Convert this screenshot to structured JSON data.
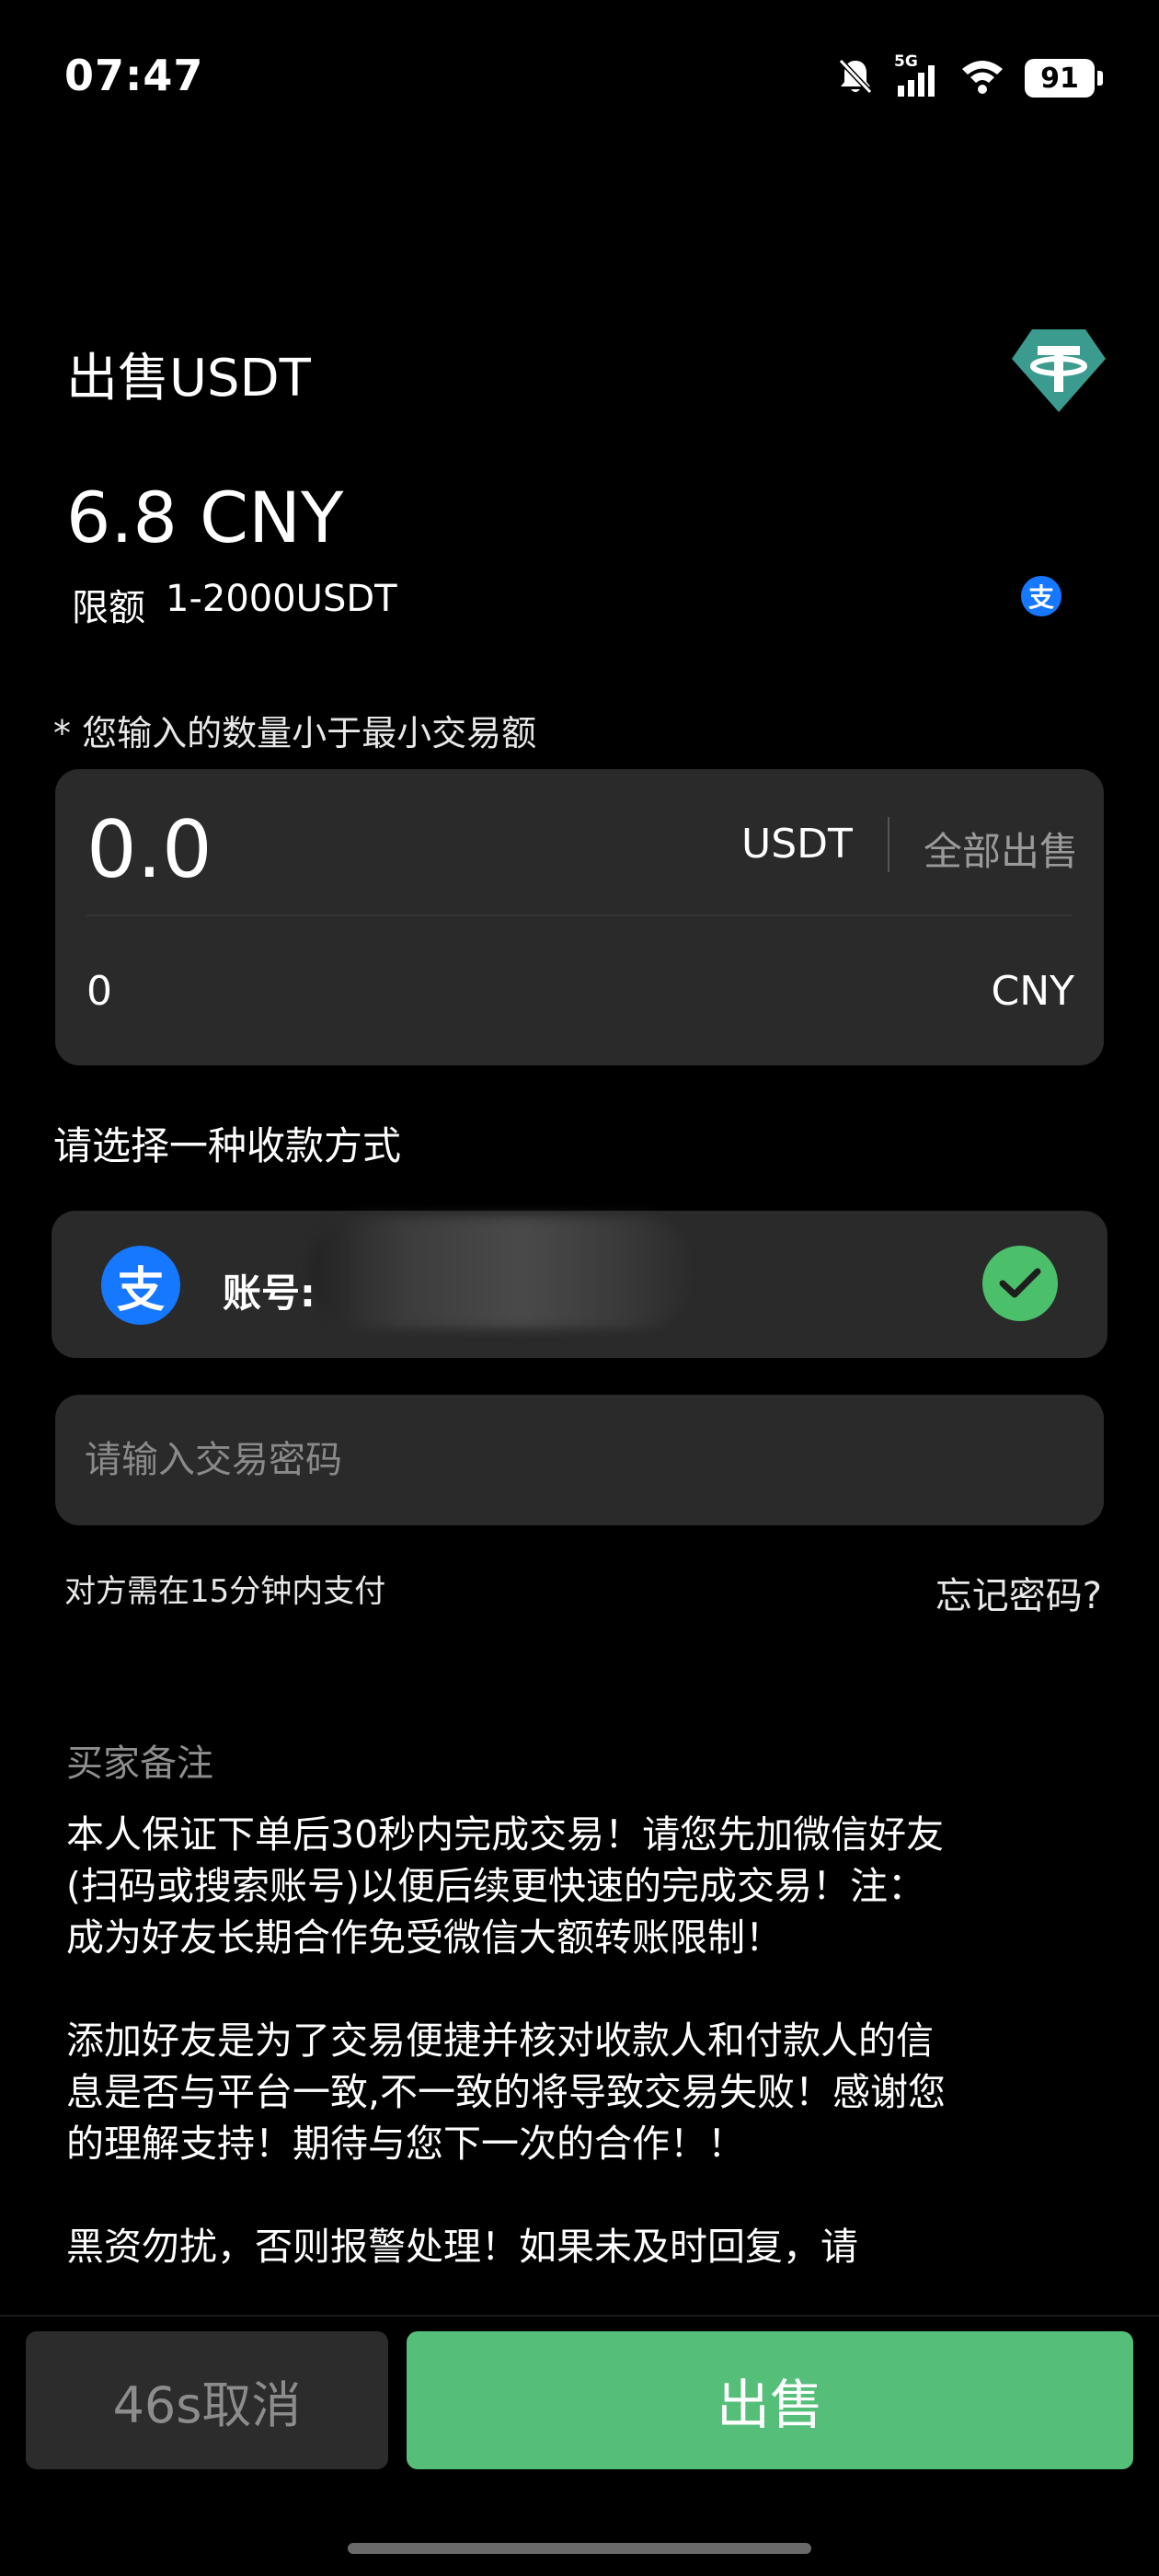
{
  "status_bar": {
    "time": "07:47",
    "network": "5G",
    "battery": "91",
    "icons": [
      "bell-off-icon",
      "signal-5g-icon",
      "wifi-icon",
      "battery-icon"
    ]
  },
  "header": {
    "title": "出售USDT",
    "price": "6.8 CNY",
    "limit_label": "限额",
    "limit_value": "1-2000USDT",
    "token_icon": "tether-icon",
    "payment_icon": "alipay-icon"
  },
  "warning": "* 您输入的数量小于最小交易额",
  "amount": {
    "usdt_value": "0.0",
    "usdt_unit": "USDT",
    "sell_all_label": "全部出售",
    "cny_value": "0",
    "cny_unit": "CNY"
  },
  "payment": {
    "section_label": "请选择一种收款方式",
    "method_icon_glyph": "支",
    "account_label": "账号:",
    "selected": true
  },
  "password": {
    "placeholder": "请输入交易密码"
  },
  "deadline_text": "对方需在15分钟内支付",
  "forgot_password": "忘记密码?",
  "buyer_note": {
    "title": "买家备注",
    "paragraphs": [
      "本人保证下单后30秒内完成交易！请您先加微信好友(扫码或搜索账号)以便后续更快速的完成交易！注：成为好友长期合作免受微信大额转账限制！",
      "添加好友是为了交易便捷并核对收款人和付款人的信息是否与平台一致,不一致的将导致交易失败！感谢您的理解支持！期待与您下一次的合作！！",
      "黑资勿扰，否则报警处理！如果未及时回复，请"
    ]
  },
  "actions": {
    "cancel_label": "46s取消",
    "sell_label": "出售"
  },
  "colors": {
    "background": "#000000",
    "card": "#2a2a2a",
    "sell_green": "#55bf79",
    "check_green": "#4cbf6b",
    "alipay_blue": "#1677ff",
    "tether_teal": "#3a9b8e"
  }
}
